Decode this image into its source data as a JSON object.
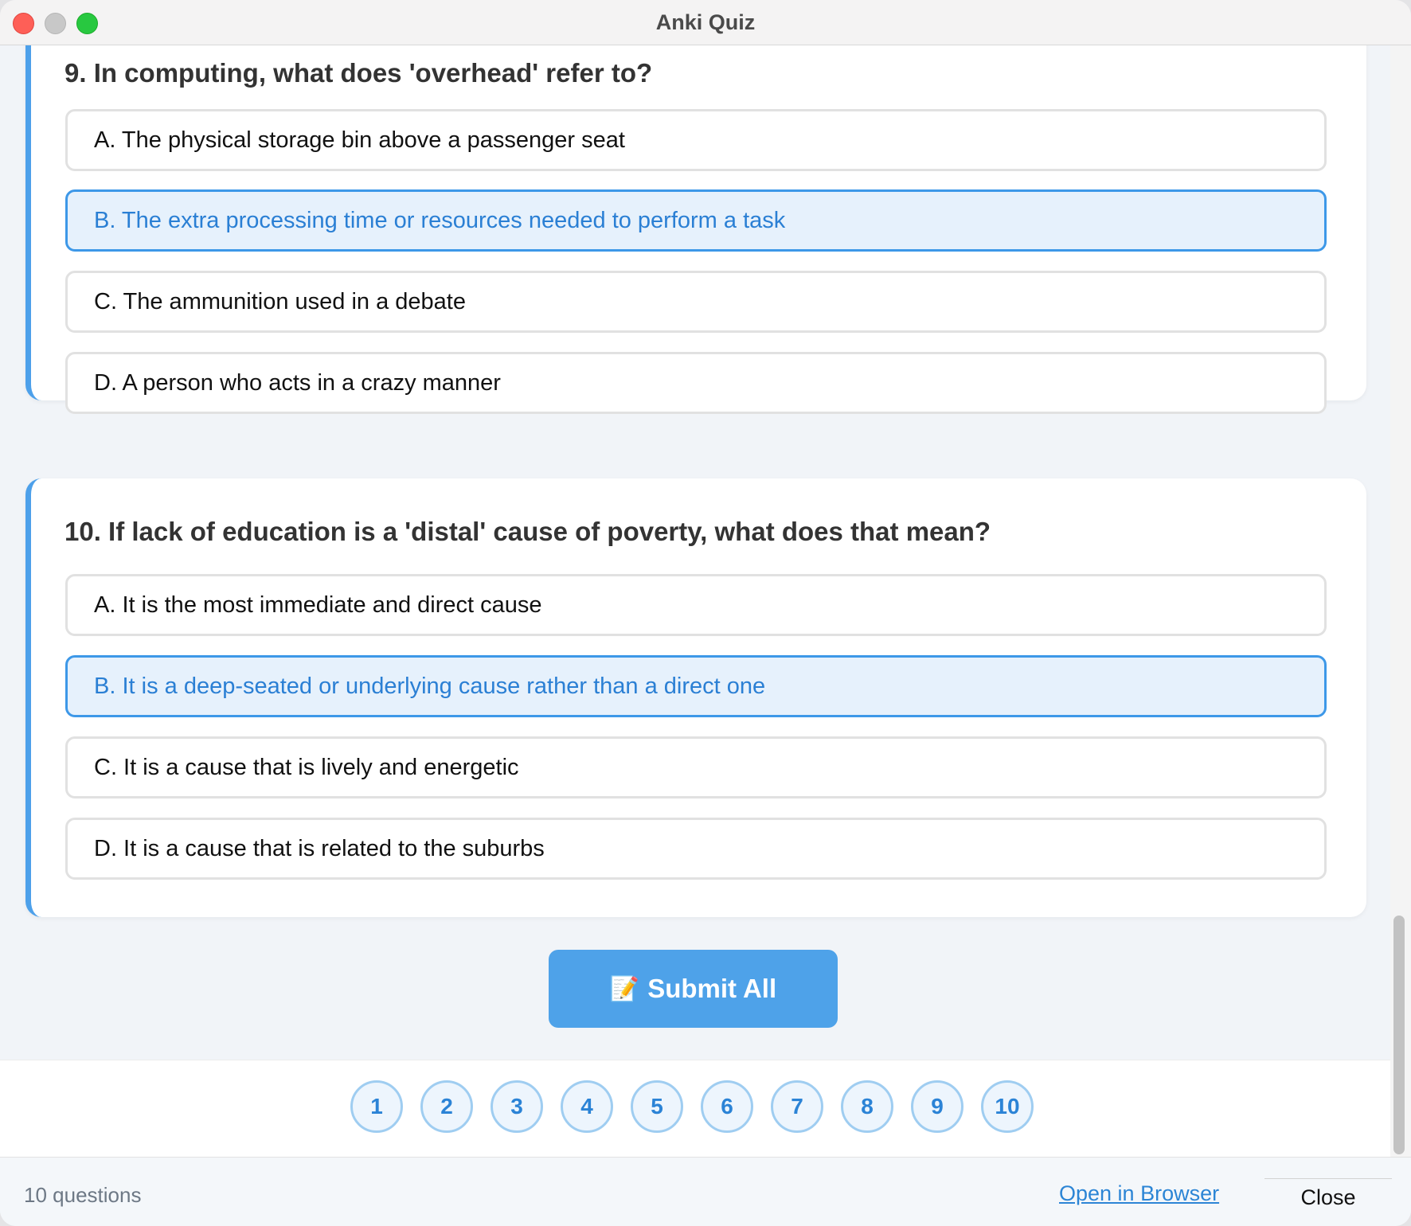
{
  "window": {
    "title": "Anki Quiz"
  },
  "questions": [
    {
      "title": "9. In computing, what does 'overhead' refer to?",
      "options": [
        {
          "label": "A. The physical storage bin above a passenger seat",
          "selected": false
        },
        {
          "label": "B. The extra processing time or resources needed to perform a task",
          "selected": true
        },
        {
          "label": "C. The ammunition used in a debate",
          "selected": false
        },
        {
          "label": "D. A person who acts in a crazy manner",
          "selected": false
        }
      ]
    },
    {
      "title": "10. If lack of education is a 'distal' cause of poverty, what does that mean?",
      "options": [
        {
          "label": "A. It is the most immediate and direct cause",
          "selected": false
        },
        {
          "label": "B. It is a deep-seated or underlying cause rather than a direct one",
          "selected": true
        },
        {
          "label": "C. It is a cause that is lively and energetic",
          "selected": false
        },
        {
          "label": "D. It is a cause that is related to the suburbs",
          "selected": false
        }
      ]
    }
  ],
  "submit": {
    "icon": "📝",
    "label": "Submit All"
  },
  "pager": {
    "pages": [
      "1",
      "2",
      "3",
      "4",
      "5",
      "6",
      "7",
      "8",
      "9",
      "10"
    ]
  },
  "footer": {
    "count": "10 questions",
    "open_browser": "Open in Browser",
    "close": "Close"
  },
  "colors": {
    "accent": "#4da0ea",
    "selected_bg": "#e6f1fc",
    "selected_text": "#2a7fd4"
  }
}
